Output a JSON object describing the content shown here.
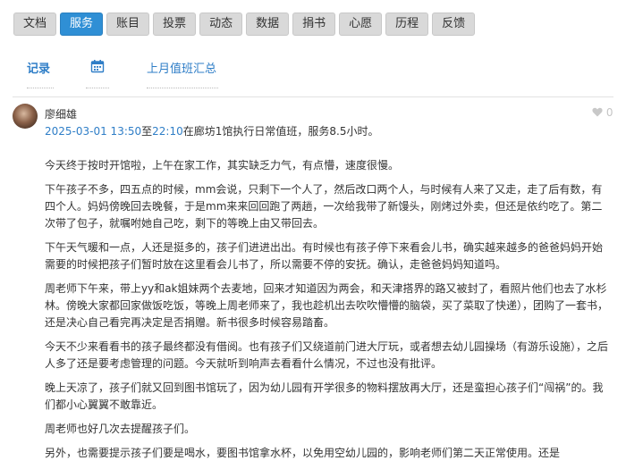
{
  "nav": {
    "items": [
      {
        "label": "文档"
      },
      {
        "label": "服务"
      },
      {
        "label": "账目"
      },
      {
        "label": "投票"
      },
      {
        "label": "动态"
      },
      {
        "label": "数据"
      },
      {
        "label": "捐书"
      },
      {
        "label": "心愿"
      },
      {
        "label": "历程"
      },
      {
        "label": "反馈"
      }
    ],
    "active": "服务"
  },
  "subtabs": {
    "records": "记录",
    "calendar_icon": "calendar-icon",
    "monthly": "上月值班汇总"
  },
  "post": {
    "author": "廖细雄",
    "like_count": "0",
    "like_icon": "heart-icon",
    "time_start": "2025-03-01 13:50",
    "time_sep": "至",
    "time_end": "22:10",
    "summary": "在廊坊1馆执行日常值班，服务8.5小时。",
    "paragraphs": [
      "今天终于按时开馆啦，上午在家工作，其实缺乏力气，有点懵，速度很慢。",
      "下午孩子不多，四五点的时候，mm会说，只剩下一个人了，然后改口两个人，与时候有人来了又走，走了后有数，有四个人。妈妈傍晚回去晚餐，于是mm来来回回跑了两趟，一次给我带了新馒头，刚烤过外卖，但还是依约吃了。第二次带了包子，就嘱咐她自己吃，剩下的等晚上由又带回去。",
      "下午天气暖和一点，人还是挺多的，孩子们进进出出。有时候也有孩子停下来看会儿书，确实越来越多的爸爸妈妈开始需要的时候把孩子们暂时放在这里看会儿书了，所以需要不停的安抚。确认，走爸爸妈妈知道吗。",
      "周老师下午来，带上yy和ak姐妹两个去麦地，回来才知道因为两会，和天津搭界的路又被封了，看照片他们也去了水杉林。傍晚大家都回家做饭吃饭，等晚上周老师来了，我也趁机出去吹吹懵懵的脑袋，买了菜取了快递），团购了一套书，还是决心自己看完再决定是否捐赠。新书很多时候容易踏畜。",
      "今天不少来看看书的孩子最终都没有借阅。也有孩子们又绕道前门进大厅玩，或者想去幼儿园操场（有游乐设施），之后人多了还是要考虑管理的问题。今天就听到响声去看看什么情况，不过也没有批评。",
      "晚上天凉了，孩子们就又回到图书馆玩了，因为幼儿园有开学很多的物料摆放再大厅，还是蛮担心孩子们“闯祸”的。我们都小心翼翼不敢靠近。",
      "周老师也好几次去提醒孩子们。",
      "另外，也需要提示孩子们要是喝水，要图书馆拿水杯，以免用空幼儿园的，影响老师们第二天正常使用。还是"
    ]
  },
  "colors": {
    "accent": "#2f8fd5",
    "link": "#2f7ec7",
    "nav_bg": "#d9d9d9"
  }
}
